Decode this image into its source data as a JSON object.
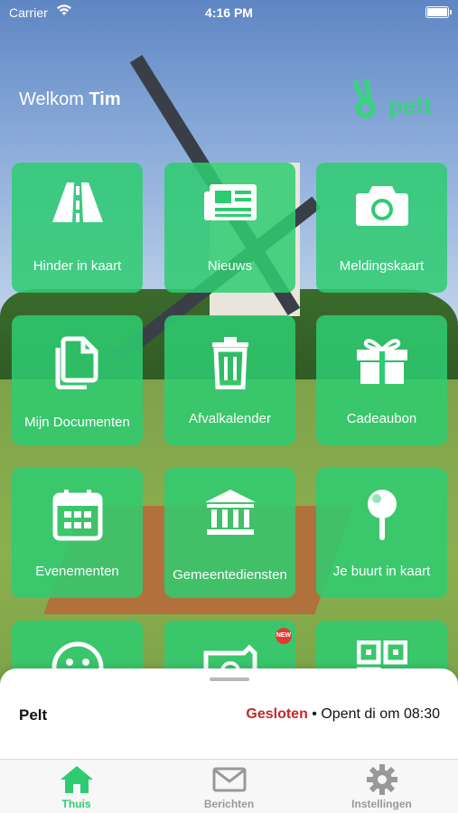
{
  "status_bar": {
    "carrier": "Carrier",
    "time": "4:16 PM"
  },
  "header": {
    "welcome_prefix": "Welkom",
    "user_name": "Tim",
    "logo_text": "pelt"
  },
  "tiles": [
    {
      "label": "Hinder in kaart",
      "icon": "road-icon"
    },
    {
      "label": "Nieuws",
      "icon": "newspaper-icon"
    },
    {
      "label": "Meldingskaart",
      "icon": "camera-icon"
    },
    {
      "label": "Mijn Documenten",
      "icon": "documents-icon"
    },
    {
      "label": "Afvalkalender",
      "icon": "trash-icon"
    },
    {
      "label": "Cadeaubon",
      "icon": "gift-icon"
    },
    {
      "label": "Evenementen",
      "icon": "calendar-icon"
    },
    {
      "label": "Gemeentediensten",
      "icon": "building-icon"
    },
    {
      "label": "Je buurt in kaart",
      "icon": "pin-icon"
    },
    {
      "label": "",
      "icon": "smiley-icon"
    },
    {
      "label": "",
      "icon": "photo-icon",
      "badge": "NEW"
    },
    {
      "label": "",
      "icon": "qr-icon"
    }
  ],
  "info_sheet": {
    "place": "Pelt",
    "status": "Gesloten",
    "separator": "•",
    "opening": "Opent di om 08:30"
  },
  "tab_bar": [
    {
      "label": "Thuis",
      "icon": "home-icon",
      "active": true
    },
    {
      "label": "Berichten",
      "icon": "mail-icon",
      "active": false
    },
    {
      "label": "Instellingen",
      "icon": "gear-icon",
      "active": false
    }
  ],
  "colors": {
    "accent": "#2ECC71",
    "closed": "#C62828"
  }
}
